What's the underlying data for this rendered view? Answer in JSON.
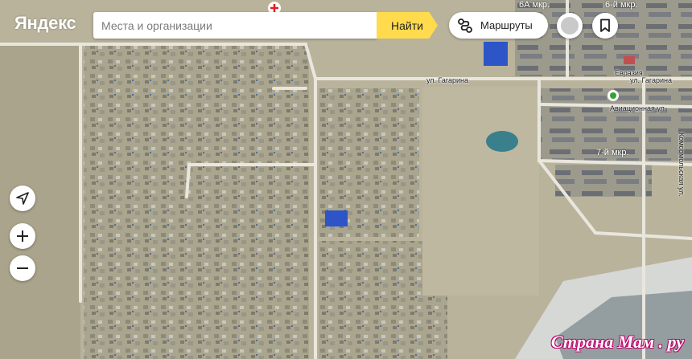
{
  "app": {
    "logo_text": "Яндекс"
  },
  "search": {
    "placeholder": "Места и организации",
    "value": ""
  },
  "toolbar": {
    "find_label": "Найти",
    "routes_label": "Маршруты"
  },
  "icons": {
    "routes": "routes-icon",
    "bookmark": "bookmark-icon",
    "geolocation": "geolocation-arrow-icon",
    "zoom_in": "plus-icon",
    "zoom_out": "minus-icon"
  },
  "map": {
    "streets": {
      "gagarina_left": "ул. Гагарина",
      "gagarina_right": "ул. Гагарина",
      "aviatsionnaya": "Авиационная ул.",
      "komsomolskaya": "Комсомольская ул."
    },
    "districts": {
      "mkr_6a": "6А мкр.",
      "mkr_6": "6-й мкр.",
      "mkr_7": "7-й мкр."
    },
    "places": {
      "evraziya": "Евразия"
    }
  },
  "watermark": "Страна Мам . ру",
  "colors": {
    "accent_yellow": "#ffdb4d",
    "ground": "#b9b39c"
  }
}
